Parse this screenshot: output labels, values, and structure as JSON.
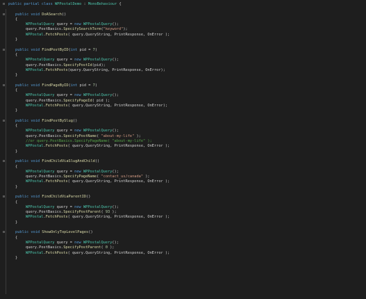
{
  "theme": {
    "background": "#1e1e1e",
    "keyword": "#569cd6",
    "type": "#4ec9b0",
    "method": "#dcdcaa",
    "string": "#d69d85",
    "comment": "#57a64a",
    "number": "#b5cea8",
    "text": "#d4d4d4"
  },
  "lines": [
    {
      "fold": "minus",
      "indent": 0,
      "tokens": [
        [
          "kw",
          "public "
        ],
        [
          "kw",
          "partial "
        ],
        [
          "kw",
          "class "
        ],
        [
          "ty",
          "WPPostalDemo"
        ],
        [
          "pl",
          " : "
        ],
        [
          "ty",
          "MonoBehaviour"
        ],
        [
          "pl",
          " {"
        ]
      ]
    },
    {
      "indent": 0,
      "tokens": []
    },
    {
      "fold": "minus",
      "indent": 1,
      "tokens": [
        [
          "kw",
          "public "
        ],
        [
          "kw",
          "void "
        ],
        [
          "fn",
          "DoASearch"
        ],
        [
          "pl",
          "()"
        ]
      ]
    },
    {
      "indent": 1,
      "tokens": [
        [
          "pl",
          "{"
        ]
      ]
    },
    {
      "indent": 2,
      "tokens": [
        [
          "ty",
          "WPPostalQuery"
        ],
        [
          "pl",
          " query = "
        ],
        [
          "kw",
          "new "
        ],
        [
          "ty",
          "WPPostalQuery"
        ],
        [
          "pl",
          "();"
        ]
      ]
    },
    {
      "indent": 2,
      "tokens": [
        [
          "pl",
          "query.PostBasics."
        ],
        [
          "fn",
          "SpecifySearchTerm"
        ],
        [
          "pl",
          "("
        ],
        [
          "st",
          "\"keyword\""
        ],
        [
          "pl",
          ");"
        ]
      ]
    },
    {
      "indent": 2,
      "tokens": [
        [
          "ty",
          "WPPostal"
        ],
        [
          "pl",
          "."
        ],
        [
          "fn",
          "FetchPosts"
        ],
        [
          "pl",
          "( query.QueryString, PrintResponse, OnError );"
        ]
      ]
    },
    {
      "indent": 1,
      "tokens": [
        [
          "pl",
          "}"
        ]
      ]
    },
    {
      "indent": 0,
      "tokens": []
    },
    {
      "fold": "minus",
      "indent": 1,
      "tokens": [
        [
          "kw",
          "public "
        ],
        [
          "kw",
          "void "
        ],
        [
          "fn",
          "FindPostByID"
        ],
        [
          "pl",
          "("
        ],
        [
          "kw",
          "int "
        ],
        [
          "pl",
          "pid = "
        ],
        [
          "nm",
          "7"
        ],
        [
          "pl",
          ")"
        ]
      ]
    },
    {
      "indent": 1,
      "tokens": [
        [
          "pl",
          "{"
        ]
      ]
    },
    {
      "indent": 2,
      "tokens": [
        [
          "ty",
          "WPPostalQuery"
        ],
        [
          "pl",
          " query = "
        ],
        [
          "kw",
          "new "
        ],
        [
          "ty",
          "WPPostalQuery"
        ],
        [
          "pl",
          "();"
        ]
      ]
    },
    {
      "indent": 2,
      "tokens": [
        [
          "pl",
          "query.PostBasics."
        ],
        [
          "fn",
          "SpecifyPostId"
        ],
        [
          "pl",
          "(pid);"
        ]
      ]
    },
    {
      "indent": 2,
      "tokens": [
        [
          "ty",
          "WPPostal"
        ],
        [
          "pl",
          "."
        ],
        [
          "fn",
          "FetchPosts"
        ],
        [
          "pl",
          "(query.QueryString, PrintResponse, OnError);"
        ]
      ]
    },
    {
      "indent": 1,
      "tokens": [
        [
          "pl",
          "}"
        ]
      ]
    },
    {
      "indent": 0,
      "tokens": []
    },
    {
      "fold": "minus",
      "indent": 1,
      "tokens": [
        [
          "kw",
          "public "
        ],
        [
          "kw",
          "void "
        ],
        [
          "fn",
          "FindPageByID"
        ],
        [
          "pl",
          "("
        ],
        [
          "kw",
          "int "
        ],
        [
          "pl",
          "pid = "
        ],
        [
          "nm",
          "7"
        ],
        [
          "pl",
          ")"
        ]
      ]
    },
    {
      "indent": 1,
      "tokens": [
        [
          "pl",
          "{"
        ]
      ]
    },
    {
      "indent": 2,
      "tokens": [
        [
          "ty",
          "WPPostalQuery"
        ],
        [
          "pl",
          " query = "
        ],
        [
          "kw",
          "new "
        ],
        [
          "ty",
          "WPPostalQuery"
        ],
        [
          "pl",
          "();"
        ]
      ]
    },
    {
      "indent": 2,
      "tokens": [
        [
          "pl",
          "query.PostBasics."
        ],
        [
          "fn",
          "SpecifyPageId"
        ],
        [
          "pl",
          "( pid );"
        ]
      ]
    },
    {
      "indent": 2,
      "tokens": [
        [
          "ty",
          "WPPostal"
        ],
        [
          "pl",
          "."
        ],
        [
          "fn",
          "FetchPosts"
        ],
        [
          "pl",
          "( query.QueryString, PrintResponse, OnError);"
        ]
      ]
    },
    {
      "indent": 1,
      "tokens": [
        [
          "pl",
          "}"
        ]
      ]
    },
    {
      "indent": 0,
      "tokens": []
    },
    {
      "fold": "minus",
      "indent": 1,
      "tokens": [
        [
          "kw",
          "public "
        ],
        [
          "kw",
          "void "
        ],
        [
          "fn",
          "FindPostBySlug"
        ],
        [
          "pl",
          "()"
        ]
      ]
    },
    {
      "indent": 1,
      "tokens": [
        [
          "pl",
          "{"
        ]
      ]
    },
    {
      "indent": 2,
      "tokens": [
        [
          "ty",
          "WPPostalQuery"
        ],
        [
          "pl",
          " query = "
        ],
        [
          "kw",
          "new "
        ],
        [
          "ty",
          "WPPostalQuery"
        ],
        [
          "pl",
          "();"
        ]
      ]
    },
    {
      "indent": 2,
      "tokens": [
        [
          "pl",
          "query.PostBasics."
        ],
        [
          "fn",
          "SpecifyPostName"
        ],
        [
          "pl",
          "( "
        ],
        [
          "st",
          "\"about-my-life\""
        ],
        [
          "pl",
          " );"
        ]
      ]
    },
    {
      "indent": 2,
      "tokens": [
        [
          "cm",
          "//or query.PostBasics.SpecifyPageName( \"about-my-life\" );"
        ]
      ]
    },
    {
      "indent": 2,
      "tokens": [
        [
          "ty",
          "WPPostal"
        ],
        [
          "pl",
          "."
        ],
        [
          "fn",
          "FetchPosts"
        ],
        [
          "pl",
          "( query.QueryString, PrintResponse, OnError );"
        ]
      ]
    },
    {
      "indent": 1,
      "tokens": [
        [
          "pl",
          "}"
        ]
      ]
    },
    {
      "indent": 0,
      "tokens": []
    },
    {
      "fold": "minus",
      "indent": 1,
      "tokens": [
        [
          "kw",
          "public "
        ],
        [
          "kw",
          "void "
        ],
        [
          "fn",
          "FindChildViaSlugAndChild"
        ],
        [
          "pl",
          "()"
        ]
      ]
    },
    {
      "indent": 1,
      "tokens": [
        [
          "pl",
          "{"
        ]
      ]
    },
    {
      "indent": 2,
      "tokens": [
        [
          "ty",
          "WPPostalQuery"
        ],
        [
          "pl",
          " query = "
        ],
        [
          "kw",
          "new "
        ],
        [
          "ty",
          "WPPostalQuery"
        ],
        [
          "pl",
          "();"
        ]
      ]
    },
    {
      "indent": 2,
      "tokens": [
        [
          "pl",
          "query.PostBasics."
        ],
        [
          "fn",
          "SpecifyPageName"
        ],
        [
          "pl",
          "( "
        ],
        [
          "st",
          "\"contact_us/canada\""
        ],
        [
          "pl",
          " );"
        ]
      ]
    },
    {
      "indent": 2,
      "tokens": [
        [
          "ty",
          "WPPostal"
        ],
        [
          "pl",
          "."
        ],
        [
          "fn",
          "FetchPosts"
        ],
        [
          "pl",
          "( query.QueryString, PrintResponse, OnError );"
        ]
      ]
    },
    {
      "indent": 1,
      "tokens": [
        [
          "pl",
          "}"
        ]
      ]
    },
    {
      "indent": 0,
      "tokens": []
    },
    {
      "fold": "minus",
      "indent": 1,
      "tokens": [
        [
          "kw",
          "public "
        ],
        [
          "kw",
          "void "
        ],
        [
          "fn",
          "FindChildViaParentID"
        ],
        [
          "pl",
          "()"
        ]
      ]
    },
    {
      "indent": 1,
      "tokens": [
        [
          "pl",
          "{"
        ]
      ]
    },
    {
      "indent": 2,
      "tokens": [
        [
          "ty",
          "WPPostalQuery"
        ],
        [
          "pl",
          " query = "
        ],
        [
          "kw",
          "new "
        ],
        [
          "ty",
          "WPPostalQuery"
        ],
        [
          "pl",
          "();"
        ]
      ]
    },
    {
      "indent": 2,
      "tokens": [
        [
          "pl",
          "query.PostBasics."
        ],
        [
          "fn",
          "SpecifyPostParent"
        ],
        [
          "pl",
          "( "
        ],
        [
          "nm",
          "93"
        ],
        [
          "pl",
          " );"
        ]
      ]
    },
    {
      "indent": 2,
      "tokens": [
        [
          "ty",
          "WPPostal"
        ],
        [
          "pl",
          "."
        ],
        [
          "fn",
          "FetchPosts"
        ],
        [
          "pl",
          "( query.QueryString, PrintResponse, OnError );"
        ]
      ]
    },
    {
      "indent": 1,
      "tokens": [
        [
          "pl",
          "}"
        ]
      ]
    },
    {
      "indent": 0,
      "tokens": []
    },
    {
      "fold": "minus",
      "indent": 1,
      "tokens": [
        [
          "kw",
          "public "
        ],
        [
          "kw",
          "void "
        ],
        [
          "fn",
          "ShowOnlyTopLevelPages"
        ],
        [
          "pl",
          "()"
        ]
      ]
    },
    {
      "indent": 1,
      "tokens": [
        [
          "pl",
          "{"
        ]
      ]
    },
    {
      "indent": 2,
      "tokens": [
        [
          "ty",
          "WPPostalQuery"
        ],
        [
          "pl",
          " query = "
        ],
        [
          "kw",
          "new "
        ],
        [
          "ty",
          "WPPostalQuery"
        ],
        [
          "pl",
          "();"
        ]
      ]
    },
    {
      "indent": 2,
      "tokens": [
        [
          "pl",
          "query.PostBasics."
        ],
        [
          "fn",
          "SpecifyPostParent"
        ],
        [
          "pl",
          "( "
        ],
        [
          "nm",
          "0"
        ],
        [
          "pl",
          " );"
        ]
      ]
    },
    {
      "indent": 2,
      "tokens": [
        [
          "ty",
          "WPPostal"
        ],
        [
          "pl",
          "."
        ],
        [
          "fn",
          "FetchPosts"
        ],
        [
          "pl",
          "( query.QueryString, PrintResponse, OnError );"
        ]
      ]
    },
    {
      "indent": 1,
      "tokens": [
        [
          "pl",
          "}"
        ]
      ]
    },
    {
      "indent": 0,
      "tokens": []
    }
  ]
}
